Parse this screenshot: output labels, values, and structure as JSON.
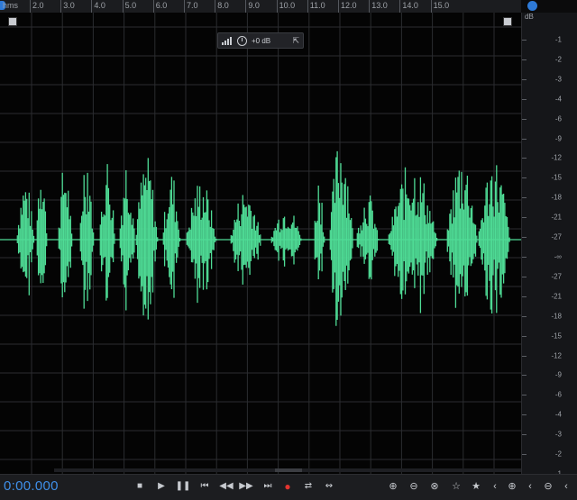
{
  "ruler": {
    "unit": "hms",
    "labels": [
      "2.0",
      "3.0",
      "4.0",
      "5.0",
      "6.0",
      "7.0",
      "8.0",
      "9.0",
      "10.0",
      "11.0",
      "12.0",
      "13.0",
      "14.0",
      "15.0"
    ]
  },
  "hud": {
    "gain": "+0 dB"
  },
  "db_scale": {
    "unit": "dB",
    "labels": [
      "-1",
      "-2",
      "-3",
      "-4",
      "-6",
      "-9",
      "-12",
      "-15",
      "-18",
      "-21",
      "-27",
      "-∞",
      "-27",
      "-21",
      "-18",
      "-15",
      "-12",
      "-9",
      "-6",
      "-4",
      "-3",
      "-2",
      "-1"
    ]
  },
  "transport": {
    "timecode": "0:00.000",
    "buttons": [
      "stop-icon",
      "play-icon",
      "pause-icon",
      "go-to-start-icon",
      "rewind-icon",
      "fast-forward-icon",
      "go-to-end-icon",
      "record-icon",
      "loop-icon",
      "skip-selection-icon"
    ],
    "zoom_buttons": [
      "zoom-in-amplitude-icon",
      "zoom-out-amplitude-icon",
      "zoom-in-time-icon",
      "zoom-out-full-icon",
      "zoom-in-selection-icon",
      "zoom-in-left-icon",
      "zoom-in-right-icon",
      "zoom-out-left-icon",
      "zoom-out-right-icon"
    ]
  },
  "colors": {
    "waveform": "#4fdc96",
    "accent": "#2e7ad8",
    "record": "#e3342f"
  }
}
